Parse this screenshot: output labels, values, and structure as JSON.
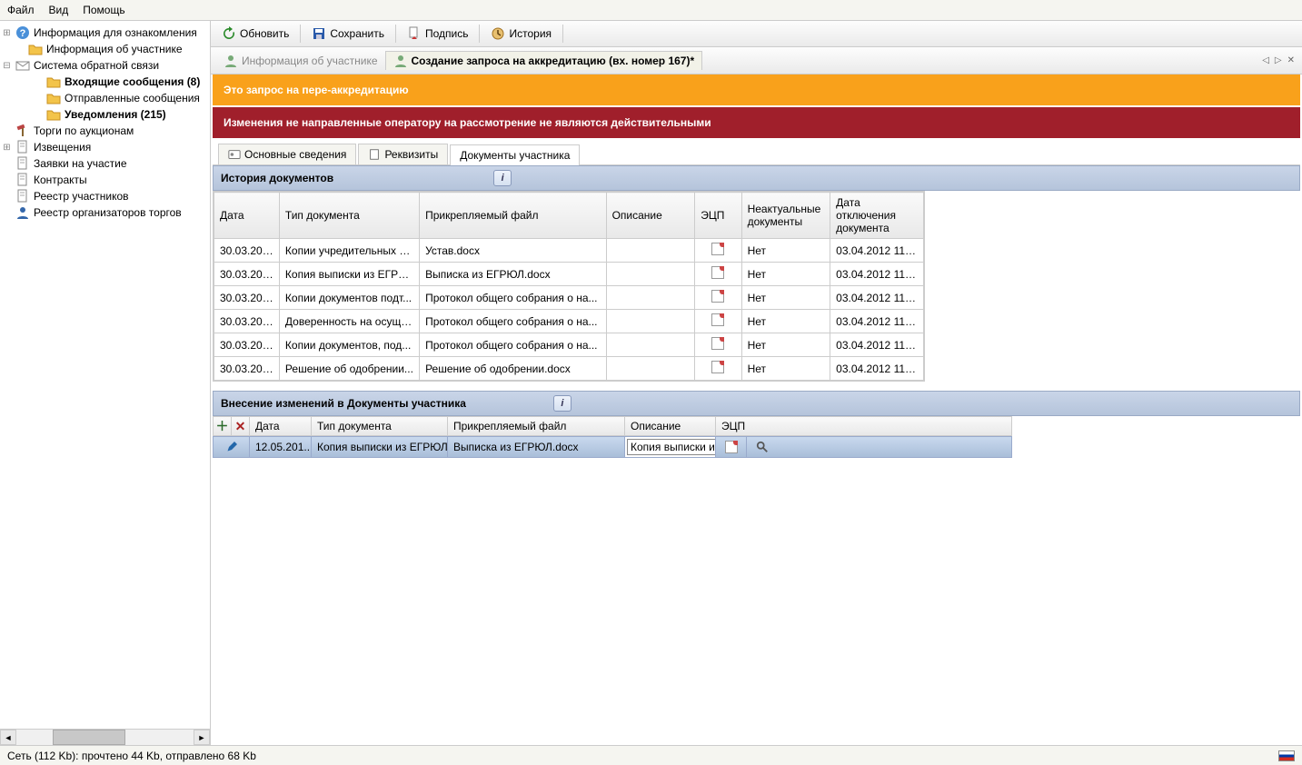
{
  "menu": {
    "file": "Файл",
    "view": "Вид",
    "help": "Помощь"
  },
  "sidebar": {
    "items": [
      {
        "exp": "+",
        "label": "Информация для ознакомления",
        "indent": 0,
        "bold": false,
        "icon": "help"
      },
      {
        "exp": "",
        "label": "Информация об участнике",
        "indent": 1,
        "bold": false,
        "icon": "folder"
      },
      {
        "exp": "-",
        "label": "Система обратной связи",
        "indent": 0,
        "bold": false,
        "icon": "mail"
      },
      {
        "exp": "",
        "label": "Входящие сообщения (8)",
        "indent": 2,
        "bold": true,
        "icon": "folder"
      },
      {
        "exp": "",
        "label": "Отправленные сообщения",
        "indent": 2,
        "bold": false,
        "icon": "folder"
      },
      {
        "exp": "",
        "label": "Уведомления (215)",
        "indent": 2,
        "bold": true,
        "icon": "folder"
      },
      {
        "exp": "",
        "label": "Торги по аукционам",
        "indent": 0,
        "bold": false,
        "icon": "hammer"
      },
      {
        "exp": "+",
        "label": "Извещения",
        "indent": 0,
        "bold": false,
        "icon": "doc"
      },
      {
        "exp": "",
        "label": "Заявки на участие",
        "indent": 0,
        "bold": false,
        "icon": "doc"
      },
      {
        "exp": "",
        "label": "Контракты",
        "indent": 0,
        "bold": false,
        "icon": "doc"
      },
      {
        "exp": "",
        "label": "Реестр участников",
        "indent": 0,
        "bold": false,
        "icon": "doc"
      },
      {
        "exp": "",
        "label": "Реестр организаторов торгов",
        "indent": 0,
        "bold": false,
        "icon": "user"
      }
    ]
  },
  "toolbar": {
    "refresh": "Обновить",
    "save": "Сохранить",
    "sign": "Подпись",
    "history": "История"
  },
  "tabs": {
    "info": "Информация об участнике",
    "request": "Создание запроса на аккредитацию (вх. номер 167)*"
  },
  "banners": {
    "orange": "Это запрос на пере-аккредитацию",
    "red": "Изменения не направленные оператору на рассмотрение не являются действительными"
  },
  "subtabs": {
    "basic": "Основные сведения",
    "requisites": "Реквизиты",
    "docs": "Документы участника"
  },
  "history": {
    "title": "История документов",
    "headers": {
      "date": "Дата",
      "type": "Тип документа",
      "file": "Прикрепляемый файл",
      "desc": "Описание",
      "ecp": "ЭЦП",
      "irrelevant": "Неактуальные документы",
      "disconnect_date": "Дата отключения документа"
    },
    "rows": [
      {
        "date": "30.03.201...",
        "type": "Копии учредительных д...",
        "file": "Устав.docx",
        "desc": "",
        "irrelevant": "Нет",
        "disconnect": "03.04.2012 11:0..."
      },
      {
        "date": "30.03.201...",
        "type": "Копия выписки из ЕГРЮЛ",
        "file": "Выписка из ЕГРЮЛ.docx",
        "desc": "",
        "irrelevant": "Нет",
        "disconnect": "03.04.2012 11:0..."
      },
      {
        "date": "30.03.201...",
        "type": "Копии документов подт...",
        "file": "Протокол общего собрания о на...",
        "desc": "",
        "irrelevant": "Нет",
        "disconnect": "03.04.2012 11:0..."
      },
      {
        "date": "30.03.201...",
        "type": "Доверенность на осуще...",
        "file": "Протокол общего собрания о на...",
        "desc": "",
        "irrelevant": "Нет",
        "disconnect": "03.04.2012 11:0..."
      },
      {
        "date": "30.03.201...",
        "type": "Копии документов, под...",
        "file": "Протокол общего собрания о на...",
        "desc": "",
        "irrelevant": "Нет",
        "disconnect": "03.04.2012 11:0..."
      },
      {
        "date": "30.03.201...",
        "type": "Решение об одобрении...",
        "file": "Решение об одобрении.docx",
        "desc": "",
        "irrelevant": "Нет",
        "disconnect": "03.04.2012 11:0..."
      }
    ]
  },
  "changes": {
    "title": "Внесение изменений в Документы участника",
    "headers": {
      "date": "Дата",
      "type": "Тип документа",
      "file": "Прикрепляемый файл",
      "desc": "Описание",
      "ecp": "ЭЦП"
    },
    "row": {
      "date": "12.05.201...",
      "type": "Копия выписки из ЕГРЮЛ",
      "file": "Выписка из ЕГРЮЛ.docx",
      "desc_input": "Копия выписки и"
    }
  },
  "status": "Сеть (112 Kb):  прочтено 44 Kb, отправлено 68 Kb"
}
